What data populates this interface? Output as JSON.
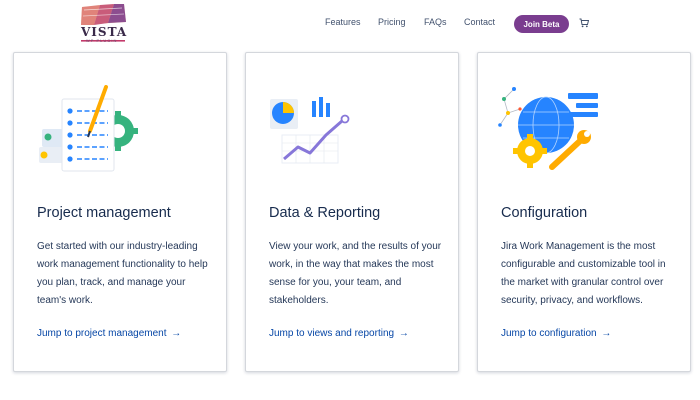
{
  "header": {
    "logo": {
      "word": "VISTA",
      "sub": "WP PLUGIN"
    },
    "nav": [
      "Features",
      "Pricing",
      "FAQs",
      "Contact"
    ],
    "cta_label": "Join Beta"
  },
  "cards": [
    {
      "title": "Project management",
      "body": "Get started with our industry-leading work management functionality to help you plan, track, and manage your team's work.",
      "link": "Jump to project management",
      "arrow": "→"
    },
    {
      "title": "Data & Reporting",
      "body": "View your work, and the results of your work, in the way that makes the most sense for you, your team, and stakeholders.",
      "link": "Jump to views and reporting",
      "arrow": "→"
    },
    {
      "title": "Configuration",
      "body": "Jira Work Management is the most configurable and customizable tool in the market with granular control over security, privacy, and workflows.",
      "link": "Jump to configuration",
      "arrow": "→"
    }
  ],
  "colors": {
    "cta": "#7a3d8f",
    "link": "#0747a6",
    "heading": "#172b4d",
    "illus_teal": "#36b37e",
    "illus_blue": "#2684ff",
    "illus_yellow": "#ffc400",
    "illus_purple": "#8777d9"
  },
  "icons": [
    "cart-icon",
    "arrow-right-icon"
  ]
}
